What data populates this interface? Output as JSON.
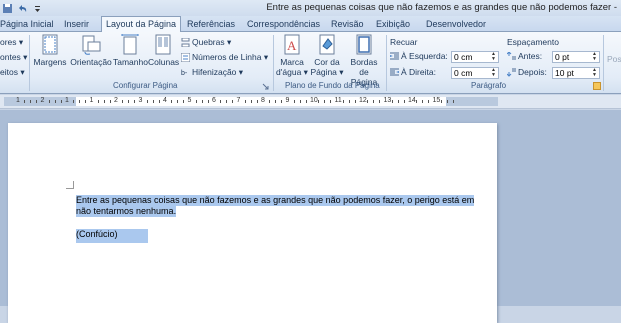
{
  "window": {
    "title": "Entre as pequenas coisas que não fazemos e as grandes que não podemos fazer -"
  },
  "tabs": [
    {
      "label": "Página Inicial"
    },
    {
      "label": "Inserir"
    },
    {
      "label": "Layout da Página"
    },
    {
      "label": "Referências"
    },
    {
      "label": "Correspondências"
    },
    {
      "label": "Revisão"
    },
    {
      "label": "Exibição"
    },
    {
      "label": "Desenvolvedor"
    }
  ],
  "ribbon": {
    "left_cut": [
      "ores ▾",
      "ontes ▾",
      "eitos ▾"
    ],
    "configurar": {
      "margens": "Margens",
      "orientacao": "Orientação",
      "tamanho": "Tamanho",
      "colunas": "Colunas",
      "quebras": "Quebras ▾",
      "numeros": "Números de Linha ▾",
      "hifenizacao": "Hifenização ▾",
      "label": "Configurar Página"
    },
    "plano": {
      "marca1": "Marca",
      "marca2": "d'água ▾",
      "cor1": "Cor da",
      "cor2": "Página ▾",
      "bordas1": "Bordas",
      "bordas2": "de Página",
      "label": "Plano de Fundo da Página"
    },
    "paragrafo": {
      "recuar": "Recuar",
      "esquerda_label": "À Esquerda:",
      "esquerda_value": "0 cm",
      "direita_label": "À Direita:",
      "direita_value": "0 cm",
      "espacamento": "Espaçamento",
      "antes_label": "Antes:",
      "antes_value": "0 pt",
      "depois_label": "Depois:",
      "depois_value": "10 pt",
      "label": "Parágrafo"
    },
    "right_cut": "Pos"
  },
  "ruler": {
    "numbers": [
      "1",
      "2",
      "1",
      "1",
      "2",
      "3",
      "4",
      "5",
      "6",
      "7",
      "8",
      "9",
      "10",
      "11",
      "12",
      "13",
      "14",
      "15"
    ]
  },
  "document": {
    "line1": "Entre as pequenas coisas que não fazemos e as grandes que não podemos fazer, o perigo está em",
    "line2": "não tentarmos nenhuma.",
    "line3": "(Confúcio)"
  },
  "colors": {
    "accent_tab": "#f4f8fd",
    "selection": "#aac8ee",
    "ribbon_text": "#1e395b"
  }
}
